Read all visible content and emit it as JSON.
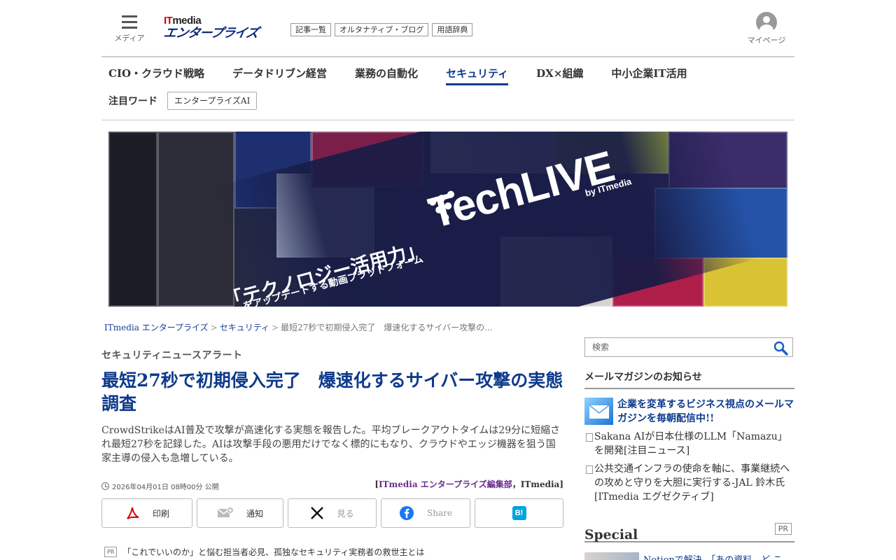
{
  "header": {
    "menu_label": "メディア",
    "logo_line1_a": "IT",
    "logo_line1_b": "media",
    "logo_line2": "エンタープライズ",
    "links": [
      "記事一覧",
      "オルタナティブ・ブログ",
      "用語辞典"
    ],
    "mypage_label": "マイページ"
  },
  "nav": {
    "items": [
      "CIO・クラウド戦略",
      "データドリブン経営",
      "業務の自動化",
      "セキュリティ",
      "DX×組織",
      "中小企業IT活用"
    ],
    "active": "セキュリティ",
    "hot_title": "注目ワード",
    "hot_words": [
      "エンタープライズAI"
    ]
  },
  "banner": {
    "brand": "TechLIVE",
    "by": "by ITmedia",
    "tagline": "「テクノロジー活用力」",
    "subline": "をアップデートする動画プラットフォーム"
  },
  "breadcrumb": {
    "items": [
      "ITmedia エンタープライズ",
      "セキュリティ"
    ],
    "current": "最短27秒で初期侵入完了　爆速化するサイバー攻撃の...",
    "separator": ">"
  },
  "article": {
    "kicker": "セキュリティニュースアラート",
    "title": "最短27秒で初期侵入完了　爆速化するサイバー攻撃の実態調査",
    "lead": "CrowdStrikeはAI普及で攻撃が高速化する実態を報告した。平均ブレークアウトタイムは29分に短縮され最短27秒を記録した。AIは攻撃手段の悪用だけでなく標的にもなり、クラウドやエッジ機器を狙う国家主導の侵入も急増している。",
    "date": "2026年04月01日 08時00分 公開",
    "author_prefix": "[",
    "author_link": "ITmedia エンタープライズ編集部",
    "author_suffix": "，ITmedia]"
  },
  "share": {
    "print": "印刷",
    "notify": "通知",
    "x": "見る",
    "facebook": "Share",
    "hatena": "B!"
  },
  "pr_line": {
    "badge": "PR",
    "text": "「これでいいのか」と悩む担当者必見、孤独なセキュリティ実務者の救世主とは"
  },
  "sidebar": {
    "search_placeholder": "検索",
    "mailmag_title": "メールマガジンのお知らせ",
    "mailmag_feature": "企業を変革するビジネス視点のメールマガジンを毎朝配信中!!",
    "mailmag_items": [
      "Sakana AIが日本仕様のLLM「Namazu」を開発[注目ニュース]",
      "公共交通インフラの使命を軸に、事業継続への攻めと守りを大胆に実行する-JAL 鈴木氏[ITmedia エグゼクティブ]"
    ],
    "special_title": "Special",
    "special_badge": "PR",
    "special_item": "Notionで解決　「あの資料、ど こ"
  },
  "colors": {
    "accent": "#0d3a8c",
    "logo_red": "#d40000",
    "author_purple": "#6a2c8c"
  }
}
